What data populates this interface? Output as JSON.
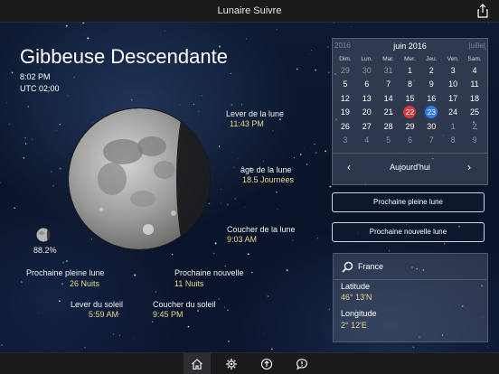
{
  "app": {
    "title": "Lunaire Suivre"
  },
  "moon": {
    "phase_name": "Gibbeuse Descendante",
    "time": "8:02 PM",
    "utc": "UTC 02:00",
    "illumination": "88.2%"
  },
  "info": {
    "moonrise_label": "Lever de la lune",
    "moonrise_value": "11:43 PM",
    "age_label": "âge de la lune",
    "age_value": "18.5 Journées",
    "moonset_label": "Coucher de la lune",
    "moonset_value": "9:03 AM",
    "next_full_label": "Prochaine pleine lune",
    "next_full_value": "26 Nuits",
    "next_new_label": "Prochaine nouvelle",
    "next_new_value": "11 Nuits",
    "sunrise_label": "Lever du soleil",
    "sunrise_value": "5:59 AM",
    "sunset_label": "Coucher du soleil",
    "sunset_value": "9:45 PM"
  },
  "calendar": {
    "prev_month": "2016",
    "month": "juin 2016",
    "next_month": "juillet",
    "weekdays": [
      "Dim.",
      "Lun.",
      "Mar.",
      "Mer.",
      "Jeu.",
      "Ven.",
      "Sam."
    ],
    "weeks": [
      [
        {
          "d": "29",
          "m": true
        },
        {
          "d": "30",
          "m": true
        },
        {
          "d": "31",
          "m": true
        },
        {
          "d": "1"
        },
        {
          "d": "2"
        },
        {
          "d": "3"
        },
        {
          "d": "4"
        }
      ],
      [
        {
          "d": "5"
        },
        {
          "d": "6"
        },
        {
          "d": "7"
        },
        {
          "d": "8"
        },
        {
          "d": "9"
        },
        {
          "d": "10"
        },
        {
          "d": "11"
        }
      ],
      [
        {
          "d": "12"
        },
        {
          "d": "13"
        },
        {
          "d": "14"
        },
        {
          "d": "15"
        },
        {
          "d": "16"
        },
        {
          "d": "17"
        },
        {
          "d": "18"
        }
      ],
      [
        {
          "d": "19"
        },
        {
          "d": "20"
        },
        {
          "d": "21"
        },
        {
          "d": "22",
          "hl": "red"
        },
        {
          "d": "23",
          "hl": "blue"
        },
        {
          "d": "24"
        },
        {
          "d": "25"
        }
      ],
      [
        {
          "d": "26"
        },
        {
          "d": "27"
        },
        {
          "d": "28"
        },
        {
          "d": "29"
        },
        {
          "d": "30"
        },
        {
          "d": "1",
          "m": true
        },
        {
          "d": "2",
          "m": true
        }
      ],
      [
        {
          "d": "3",
          "m": true
        },
        {
          "d": "4",
          "m": true
        },
        {
          "d": "5",
          "m": true
        },
        {
          "d": "6",
          "m": true
        },
        {
          "d": "7",
          "m": true
        },
        {
          "d": "8",
          "m": true
        },
        {
          "d": "9",
          "m": true
        }
      ]
    ],
    "nav_prev": "‹",
    "nav_today": "Aujourd'hui",
    "nav_next": "›"
  },
  "buttons": {
    "next_full": "Prochaine pleine lune",
    "next_new": "Prochaine nouvelle lune"
  },
  "location": {
    "country": "France",
    "latitude_label": "Latitude",
    "latitude_value": "46° 13'N",
    "longitude_label": "Longitude",
    "longitude_value": "2° 12'E"
  },
  "tabs": [
    {
      "icon": "home-icon",
      "active": true
    },
    {
      "icon": "gear-icon",
      "active": false
    },
    {
      "icon": "up-arrow-circle-icon",
      "active": false
    },
    {
      "icon": "chat-bubble-icon",
      "active": false
    }
  ],
  "colors": {
    "accent_value": "#e6d98a",
    "red_marker": "#d9383a",
    "blue_marker": "#2f7ae8"
  }
}
